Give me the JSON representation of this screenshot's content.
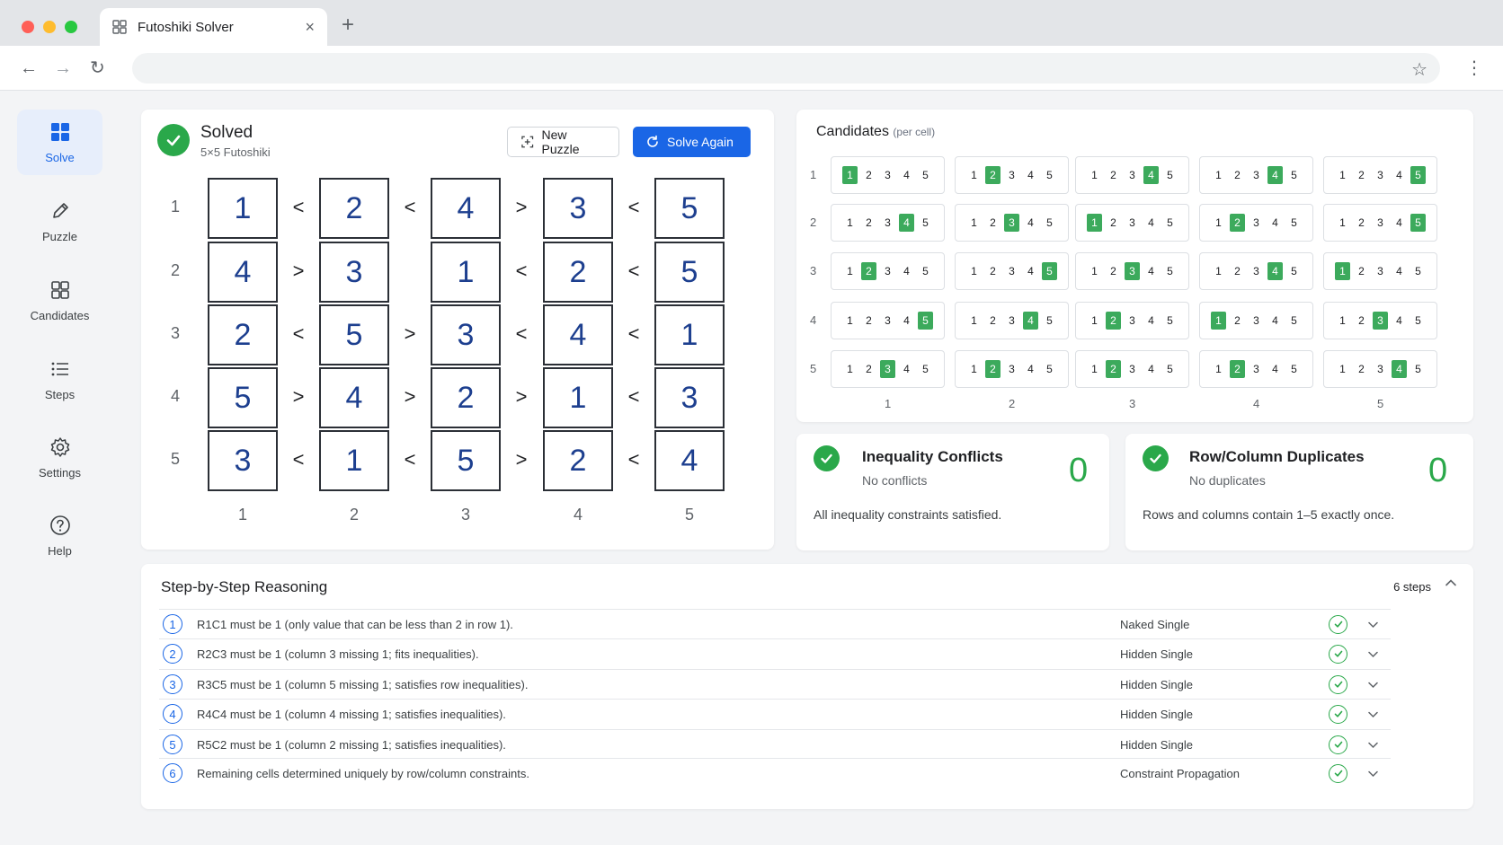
{
  "browser": {
    "tab_title": "Futoshiki Solver",
    "tab_close": "×",
    "new_tab": "+",
    "back": "←",
    "forward": "→",
    "reload": "↻",
    "bookmark": "☆",
    "menu": "⋮"
  },
  "sidebar": {
    "items": [
      {
        "label": "Solve",
        "icon": "grid-icon"
      },
      {
        "label": "Puzzle",
        "icon": "pencil-icon"
      },
      {
        "label": "Candidates",
        "icon": "candidates-grid-icon"
      },
      {
        "label": "Steps",
        "icon": "list-icon"
      },
      {
        "label": "Settings",
        "icon": "gear-icon"
      },
      {
        "label": "Help",
        "icon": "help-icon"
      }
    ]
  },
  "solver": {
    "status": "Solved",
    "subtitle": "5×5 Futoshiki",
    "new_puzzle_label": "New Puzzle",
    "solve_again_label": "Solve Again",
    "row_labels": [
      "1",
      "2",
      "3",
      "4",
      "5"
    ],
    "col_labels": [
      "1",
      "2",
      "3",
      "4",
      "5"
    ],
    "grid": [
      [
        "1",
        "2",
        "4",
        "3",
        "5"
      ],
      [
        "4",
        "3",
        "1",
        "2",
        "5"
      ],
      [
        "2",
        "5",
        "3",
        "4",
        "1"
      ],
      [
        "5",
        "4",
        "2",
        "1",
        "3"
      ],
      [
        "3",
        "1",
        "5",
        "2",
        "4"
      ]
    ],
    "h_ineq": [
      [
        "<",
        "<",
        ">",
        "<"
      ],
      [
        ">",
        "",
        "<",
        "<"
      ],
      [
        "<",
        ">",
        "<",
        "<"
      ],
      [
        ">",
        ">",
        ">",
        "<"
      ],
      [
        "<",
        "<",
        ">",
        "<"
      ]
    ]
  },
  "candidates": {
    "title": "Candidates",
    "note": "(per cell)",
    "digits": [
      "1",
      "2",
      "3",
      "4",
      "5"
    ],
    "row_labels": [
      "1",
      "2",
      "3",
      "4",
      "5"
    ],
    "col_labels": [
      "1",
      "2",
      "3",
      "4",
      "5"
    ],
    "highlight": [
      [
        1,
        2,
        4,
        4,
        5
      ],
      [
        4,
        3,
        1,
        2,
        5
      ],
      [
        2,
        5,
        3,
        4,
        1
      ],
      [
        5,
        4,
        2,
        1,
        3
      ],
      [
        3,
        2,
        2,
        2,
        4
      ]
    ]
  },
  "conflicts": {
    "inequality": {
      "title": "Inequality Conflicts",
      "sub": "No conflicts",
      "count": "0",
      "desc": "All inequality constraints satisfied."
    },
    "duplicates": {
      "title": "Row/Column Duplicates",
      "sub": "No duplicates",
      "count": "0",
      "desc": "Rows and columns contain 1–5 exactly once."
    }
  },
  "steps": {
    "title": "Step-by-Step Reasoning",
    "count_label": "6 steps",
    "items": [
      {
        "num": "1",
        "text": "R1C1 must be 1 (only value that can be less than 2 in row 1).",
        "technique": "Naked Single"
      },
      {
        "num": "2",
        "text": "R2C3 must be 1 (column 3 missing 1; fits inequalities).",
        "technique": "Hidden Single"
      },
      {
        "num": "3",
        "text": "R3C5 must be 1 (column 5 missing 1; satisfies row inequalities).",
        "technique": "Hidden Single"
      },
      {
        "num": "4",
        "text": "R4C4 must be 1 (column 4 missing 1; satisfies inequalities).",
        "technique": "Hidden Single"
      },
      {
        "num": "5",
        "text": "R5C2 must be 1 (column 2 missing 1; satisfies inequalities).",
        "technique": "Hidden Single"
      },
      {
        "num": "6",
        "text": "Remaining cells determined uniquely by row/column constraints.",
        "technique": "Constraint Propagation"
      }
    ]
  },
  "colors": {
    "accent": "#1a66e6",
    "success": "#2aa84a",
    "candidate_on": "#3caa5c"
  }
}
